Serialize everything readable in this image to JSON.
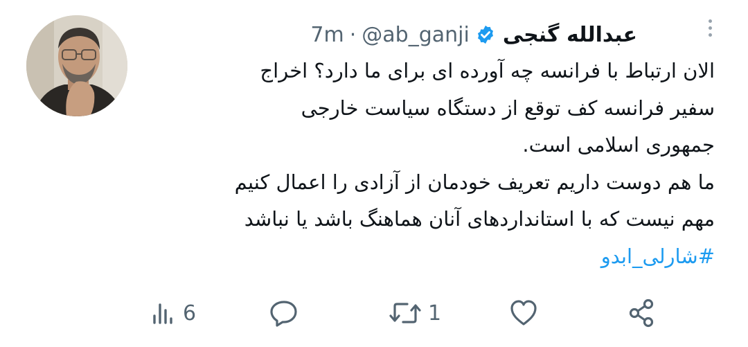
{
  "author": {
    "name": "عبدالله گنجی",
    "handle": "@ab_ganji",
    "separator": "·",
    "time": "7m",
    "verified": true,
    "avatar": "profile-photo"
  },
  "tweet": {
    "lines": [
      "الان ارتباط با فرانسه چه آورده ای برای ما دارد؟ اخراج",
      "سفیر فرانسه کف توقع از دستگاه سیاست خارجی",
      "جمهوری اسلامی است.",
      "ما هم دوست داریم تعریف خودمان از آزادی را اعمال کنیم",
      "مهم نیست که با استانداردهای آنان هماهنگ باشد یا نباشد"
    ],
    "hashtag": "#شارلی_ابدو"
  },
  "actions": {
    "views": {
      "icon": "views-icon",
      "count": "6"
    },
    "reply": {
      "icon": "reply-icon",
      "count": ""
    },
    "retweet": {
      "icon": "retweet-icon",
      "count": "1"
    },
    "like": {
      "icon": "heart-icon",
      "count": ""
    },
    "share": {
      "icon": "share-icon",
      "count": ""
    }
  },
  "colors": {
    "text": "#0f1419",
    "secondary": "#536471",
    "accent": "#1d9bf0"
  }
}
